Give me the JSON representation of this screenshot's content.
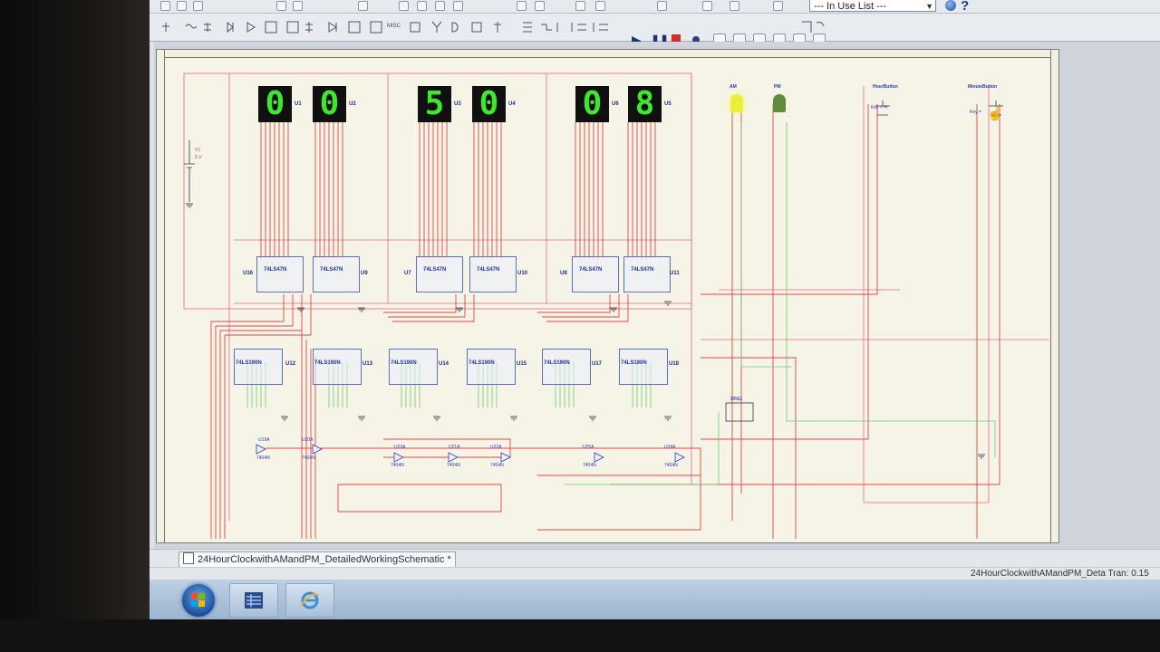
{
  "toolbar": {
    "in_use_list": "--- In Use List ---",
    "misc_label": "MISC",
    "help_icon": "help-icon"
  },
  "displays": [
    {
      "digit": "0",
      "ref": "U1"
    },
    {
      "digit": "0",
      "ref": "U2"
    },
    {
      "digit": "5",
      "ref": "U3"
    },
    {
      "digit": "0",
      "ref": "U4"
    },
    {
      "digit": "0",
      "ref": "U6"
    },
    {
      "digit": "8",
      "ref": "U5"
    }
  ],
  "decoders": [
    {
      "part": "74LS47N",
      "ref": "U16"
    },
    {
      "part": "74LS47N",
      "ref": "U9"
    },
    {
      "part": "74LS47N",
      "ref": "U7"
    },
    {
      "part": "74LS47N",
      "ref": "U10"
    },
    {
      "part": "74LS47N",
      "ref": "U8"
    },
    {
      "part": "74LS47N",
      "ref": "U11"
    }
  ],
  "counters": [
    {
      "part": "74LS190N",
      "ref": "U12"
    },
    {
      "part": "74LS190N",
      "ref": "U13"
    },
    {
      "part": "74LS190N",
      "ref": "U14"
    },
    {
      "part": "74LS190N",
      "ref": "U15"
    },
    {
      "part": "74LS190N",
      "ref": "U17"
    },
    {
      "part": "74LS190N",
      "ref": "U18"
    }
  ],
  "inverters": [
    {
      "ref": "U19A",
      "part": "7404N"
    },
    {
      "ref": "U20A",
      "part": "7404N"
    },
    {
      "ref": "U23A",
      "part": "7404N"
    },
    {
      "ref": "U21A",
      "part": "7404N"
    },
    {
      "ref": "U22A",
      "part": "7404N"
    },
    {
      "ref": "U25A",
      "part": "7404N"
    },
    {
      "ref": "U24A",
      "part": "7404N"
    }
  ],
  "leds": [
    {
      "label": "AM",
      "color": "#e9f03a"
    },
    {
      "label": "PM",
      "color": "#5e8c3c"
    }
  ],
  "buttons": [
    {
      "label": "HourButton",
      "key": "Key = H"
    },
    {
      "label": "MinuteButton",
      "key": "Key ="
    }
  ],
  "source": {
    "ref": "V1",
    "value": "5 V"
  },
  "generator": {
    "ref": "XFG1"
  },
  "document_tab": "24HourClockwithAMandPM_DetailedWorkingSchematic *",
  "status": "24HourClockwithAMandPM_Deta  Tran: 0.15"
}
